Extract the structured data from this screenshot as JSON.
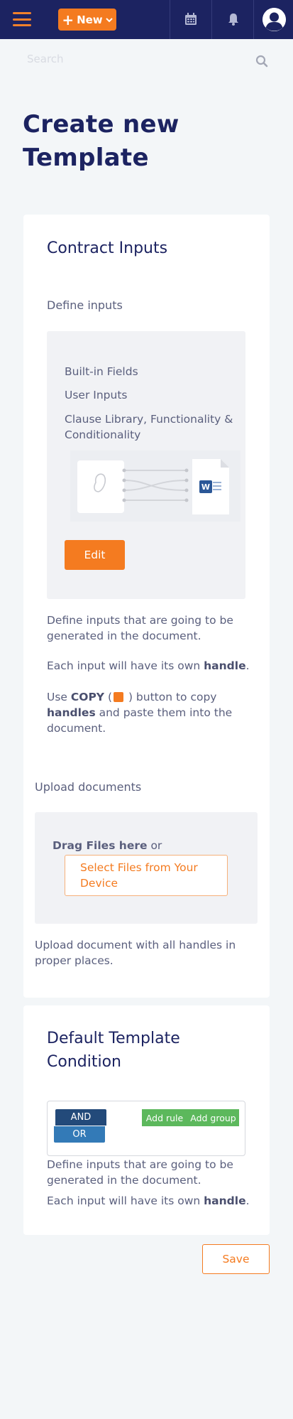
{
  "navbar": {
    "new_label": "New",
    "menu_icon": "hamburger-icon",
    "calendar_icon": "calendar-icon",
    "bell_icon": "bell-icon",
    "avatar_icon": "user-avatar-icon",
    "accent": "#f47b20",
    "background": "#1c2361"
  },
  "search": {
    "placeholder": "Search",
    "icon": "search-icon"
  },
  "page": {
    "title": "Create new Template"
  },
  "contract_inputs": {
    "title": "Contract Inputs",
    "define_label": "Define inputs",
    "features": [
      "Built-in Fields",
      "User Inputs",
      "Clause Library, Functionality & Conditionality"
    ],
    "edit_label": "Edit",
    "desc1": "Define inputs that are going to be generated in the document.",
    "desc2_pre": "Each input will have its own ",
    "desc2_bold": "handle",
    "desc2_post": ".",
    "copy_use": "Use ",
    "copy_bold": "COPY",
    "copy_paren_open": " (",
    "copy_paren_close": " ) button to copy ",
    "copy_handles": "handles",
    "copy_rest": " and paste them into the document."
  },
  "upload": {
    "label": "Upload documents",
    "drag_bold": "Drag Files here",
    "drag_or": " or",
    "select_label": "Select Files from Your Device",
    "desc": "Upload document with all handles in proper places."
  },
  "condition": {
    "title": "Default Template Condition",
    "and_label": "AND",
    "or_label": "OR",
    "add_rule": "Add rule",
    "add_group": "Add group",
    "desc1": "Define inputs that are going to be generated in the document.",
    "desc2_pre": "Each input will have its own ",
    "desc2_bold": "handle",
    "desc2_post": "."
  },
  "footer": {
    "save_label": "Save"
  }
}
